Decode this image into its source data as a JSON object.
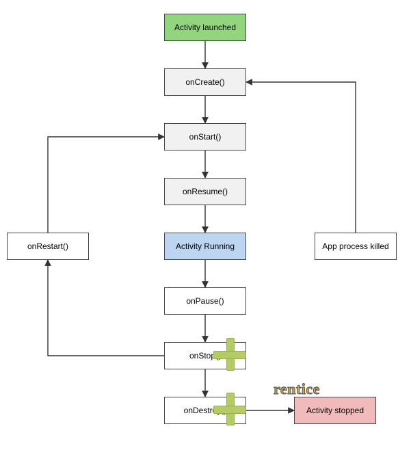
{
  "nodes": {
    "launched": {
      "label": "Activity launched",
      "fill": "#93d47f"
    },
    "onCreate": {
      "label": "onCreate()",
      "fill": "#f1f1f1"
    },
    "onStart": {
      "label": "onStart()",
      "fill": "#f1f1f1"
    },
    "onResume": {
      "label": "onResume()",
      "fill": "#f1f1f1"
    },
    "running": {
      "label": "Activity Running",
      "fill": "#bcd6f2"
    },
    "onPause": {
      "label": "onPause()",
      "fill": "#ffffff"
    },
    "onStop": {
      "label": "onStop()",
      "fill": "#ffffff"
    },
    "onDestroy": {
      "label": "onDestroy()",
      "fill": "#ffffff"
    },
    "onRestart": {
      "label": "onRestart()",
      "fill": "#ffffff"
    },
    "killed": {
      "label": "App process killed",
      "fill": "#ffffff"
    },
    "stopped": {
      "label": "Activity stopped",
      "fill": "#f2bbbb"
    }
  },
  "edges": [
    {
      "from": "launched",
      "to": "onCreate"
    },
    {
      "from": "onCreate",
      "to": "onStart"
    },
    {
      "from": "onStart",
      "to": "onResume"
    },
    {
      "from": "onResume",
      "to": "running"
    },
    {
      "from": "running",
      "to": "onPause"
    },
    {
      "from": "onPause",
      "to": "onStop"
    },
    {
      "from": "onStop",
      "to": "onDestroy"
    },
    {
      "from": "onDestroy",
      "to": "stopped"
    },
    {
      "from": "onStop",
      "to": "onRestart"
    },
    {
      "from": "onRestart",
      "to": "onStart"
    },
    {
      "from": "killed",
      "to": "onCreate"
    }
  ],
  "watermark_text": "rentice"
}
